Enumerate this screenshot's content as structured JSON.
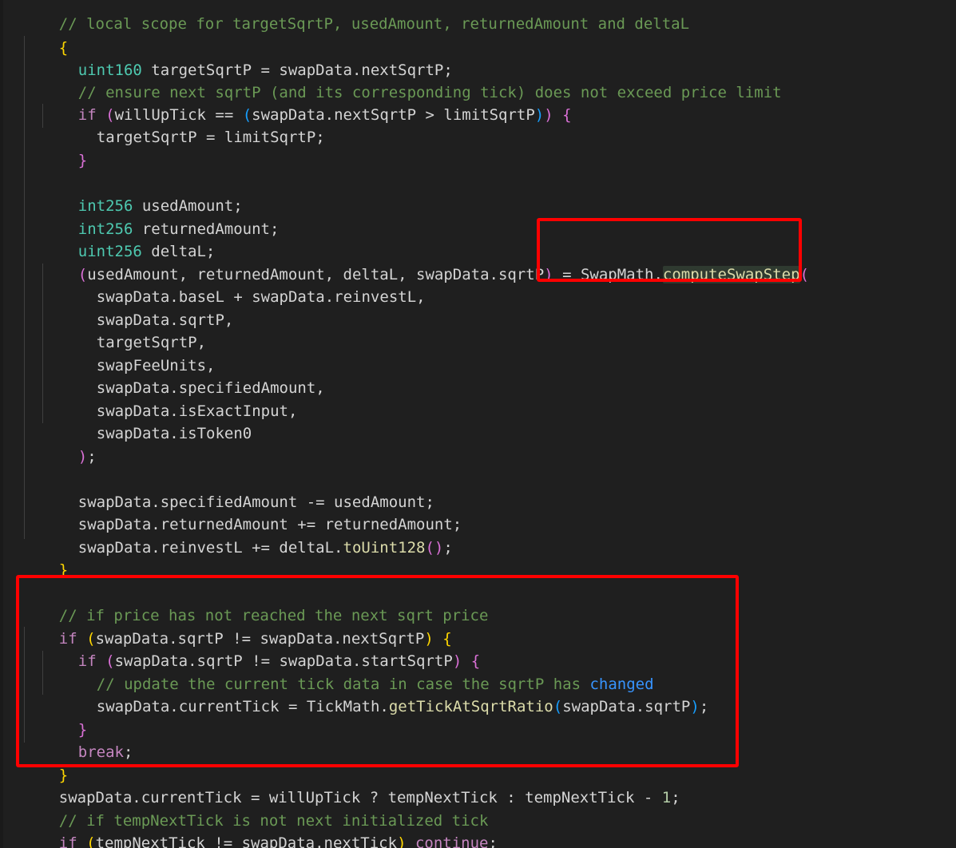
{
  "editor": {
    "language": "solidity",
    "theme_colors": {
      "background": "#1f1f1f",
      "comment": "#6a9955",
      "keyword": "#c586c0",
      "type": "#4ec9b0",
      "variable": "#9cdcfe",
      "function": "#dcdcaa",
      "number": "#b5cea8",
      "annotation_box": "#ff0000"
    },
    "lines": {
      "l0": "// local scope for targetSqrtP, usedAmount, returnedAmount and deltaL",
      "l1_brace": "{",
      "l2_type": "uint160",
      "l2_rest": " targetSqrtP = swapData.nextSqrtP;",
      "l3": "// ensure next sqrtP (and its corresponding tick) does not exceed price limit",
      "l4_kw": "if",
      "l4_cond": "willUpTick == ",
      "l4_inner": "swapData.nextSqrtP > limitSqrtP",
      "l5": "targetSqrtP = limitSqrtP;",
      "l6": "}",
      "l8_type": "int256",
      "l8_rest": " usedAmount;",
      "l9_type": "int256",
      "l9_rest": " returnedAmount;",
      "l10_type": "uint256",
      "l10_rest": " deltaL;",
      "l11_vars": "usedAmount, returnedAmount, deltaL, swapData.sqrtP",
      "l11_eq": " = ",
      "l11_cls": "SwapMath",
      "l11_dot": ".",
      "l11_fn": "computeSwapStep",
      "args": [
        "swapData.baseL + swapData.reinvestL,",
        "swapData.sqrtP,",
        "targetSqrtP,",
        "swapFeeUnits,",
        "swapData.specifiedAmount,",
        "swapData.isExactInput,",
        "swapData.isToken0"
      ],
      "l19_close": ");",
      "l21": "swapData.specifiedAmount -= usedAmount;",
      "l22": "swapData.returnedAmount += returnedAmount;",
      "l23_pre": "swapData.reinvestL += deltaL.",
      "l23_fn": "toUint128",
      "l23_end": ";",
      "l24": "}",
      "l26": "// if price has not reached the next sqrt price",
      "l27_kw": "if",
      "l27_cond": "swapData.sqrtP != swapData.nextSqrtP",
      "l28_kw": "if",
      "l28_cond": "swapData.sqrtP != swapData.startSqrtP",
      "l29_cm": "// update the current tick data in case the sqrtP has ",
      "l29_link": "changed",
      "l30_pre": "swapData.currentTick = ",
      "l30_cls": "TickMath",
      "l30_fn": "getTickAtSqrtRatio",
      "l30_arg": "swapData.sqrtP",
      "l30_end": ";",
      "l31": "}",
      "l32_kw": "break",
      "l32_end": ";",
      "l33": "}",
      "l34_pre": "swapData.currentTick = willUpTick ? tempNextTick : tempNextTick - ",
      "l34_num": "1",
      "l34_end": ";",
      "l35": "// if tempNextTick is not next initialized tick",
      "l36_kw": "if",
      "l36_cond": "tempNextTick != swapData.nextTick",
      "l36_kw2": "continue",
      "l36_end": ";"
    }
  }
}
